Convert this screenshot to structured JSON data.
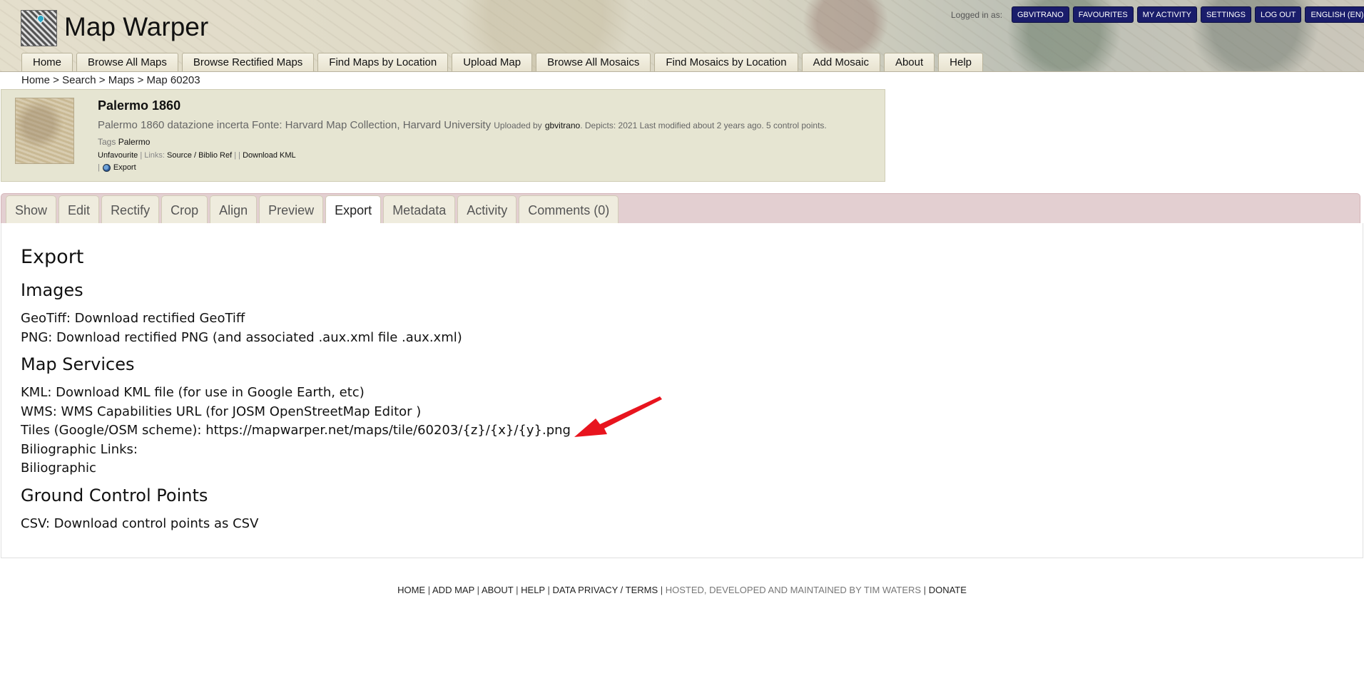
{
  "header": {
    "site_title": "Map Warper",
    "logged_in_label": "Logged in as:",
    "user_buttons": [
      "GBVITRANO",
      "FAVOURITES",
      "MY ACTIVITY",
      "SETTINGS",
      "LOG OUT",
      "ENGLISH (EN)"
    ],
    "nav": [
      "Home",
      "Browse All Maps",
      "Browse Rectified Maps",
      "Find Maps by Location",
      "Upload Map",
      "Browse All Mosaics",
      "Find Mosaics by Location",
      "Add Mosaic",
      "About",
      "Help"
    ]
  },
  "breadcrumb": "Home > Search > Maps > Map 60203",
  "map": {
    "title": "Palermo 1860",
    "description": "Palermo 1860 datazione incerta Fonte: Harvard Map Collection, Harvard University",
    "uploaded_by_label": "Uploaded by",
    "uploader": "gbvitrano",
    "meta": ". Depicts: 2021 Last modified about 2 years ago. 5 control points.",
    "tags_label": "Tags",
    "tag": "Palermo",
    "unfavourite": "Unfavourite",
    "links_label": "| Links:",
    "source_link": "Source / Biblio Ref",
    "download_kml": "Download KML",
    "export": "Export"
  },
  "tabs": [
    "Show",
    "Edit",
    "Rectify",
    "Crop",
    "Align",
    "Preview",
    "Export",
    "Metadata",
    "Activity",
    "Comments (0)"
  ],
  "active_tab": "Export",
  "export": {
    "title": "Export",
    "images_heading": "Images",
    "geotiff": "GeoTiff: Download rectified GeoTiff",
    "png": "PNG: Download rectified PNG (and associated .aux.xml file .aux.xml)",
    "services_heading": "Map Services",
    "kml": "KML: Download KML file (for use in Google Earth, etc)",
    "wms": "WMS: WMS Capabilities URL (for JOSM OpenStreetMap Editor )",
    "tiles": "Tiles (Google/OSM scheme): https://mapwarper.net/maps/tile/60203/{z}/{x}/{y}.png",
    "biblio_links": "Biliographic Links:",
    "biblio": "Biliographic",
    "gcp_heading": "Ground Control Points",
    "csv": "CSV: Download control points as CSV"
  },
  "footer": {
    "home": "HOME",
    "add_map": "ADD MAP",
    "about": "ABOUT",
    "help": "HELP",
    "privacy": "DATA PRIVACY / TERMS",
    "hosted": "HOSTED, DEVELOPED AND MAINTAINED BY TIM WATERS",
    "donate": "DONATE"
  },
  "colors": {
    "user_button_bg": "#1a1d6b",
    "tab_bar_bg": "#e3cfd1",
    "map_info_bg": "#e6e5d2",
    "arrow": "#e8141e"
  },
  "icons": [
    "map-warper-logo-icon",
    "globe-icon",
    "red-arrow-annotation"
  ]
}
